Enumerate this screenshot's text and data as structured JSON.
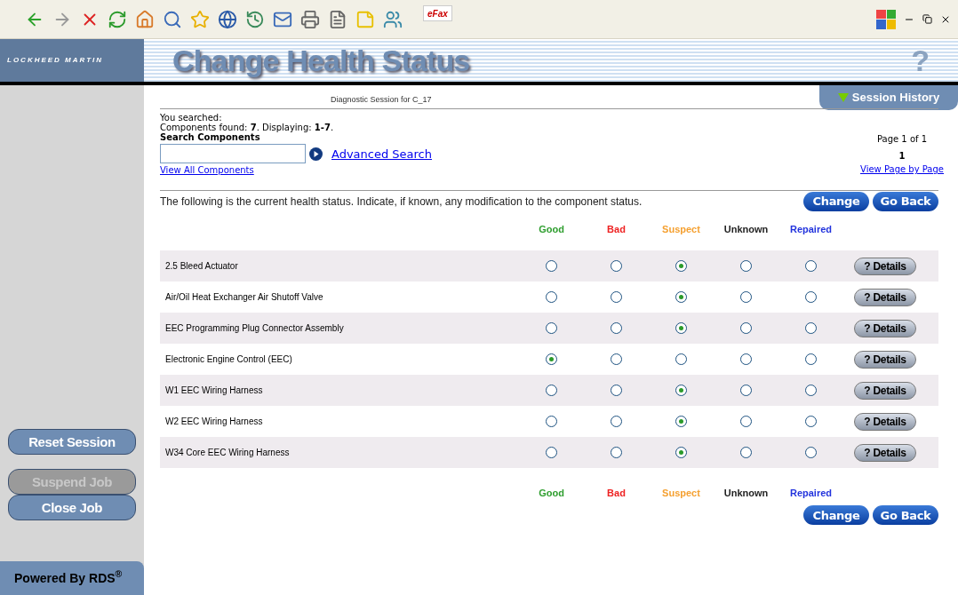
{
  "toolbar": {
    "efax_label": "eFax"
  },
  "header": {
    "brand": "LOCKHEED MARTIN",
    "title": "Change Health Status",
    "help": "?"
  },
  "sidebar": {
    "buttons": [
      {
        "label": "Reset Session",
        "disabled": false
      },
      {
        "label": "Suspend Job",
        "disabled": true
      },
      {
        "label": "Close Job",
        "disabled": false
      }
    ],
    "powered_by": "Powered By RDS$^{®}$"
  },
  "session": {
    "label": "Diagnostic Session for  C_17",
    "history_button": "Session History"
  },
  "search": {
    "searched": "You searched:",
    "found": "Components found: **7**. Displaying: **1-7**.",
    "heading": "Search Components",
    "advanced_link": "Advanced Search",
    "view_all_link": "View All Components"
  },
  "paging": {
    "page_label": "Page 1 of 1",
    "current_page": "1",
    "page_by_page_link": "View Page by Page"
  },
  "instruction": "The following is the current health status. Indicate, if known, any modification to the component status.",
  "top_buttons": [
    "Change",
    "Go Back"
  ],
  "table": {
    "header": [
      {
        "label": "Good",
        "color": "#2f9e2f"
      },
      {
        "label": "Bad",
        "color": "#ee2222"
      },
      {
        "label": "Suspect",
        "color": "#f5a030"
      },
      {
        "label": "Unknown",
        "color": "#222222"
      },
      {
        "label": "Repaired",
        "color": "#2233dd"
      }
    ],
    "rows": [
      {
        "name": "2.5 Bleed Actuator",
        "details": "? Details",
        "options": [
          {
            "selected": false
          },
          {
            "selected": false
          },
          {
            "selected": true
          },
          {
            "selected": false
          },
          {
            "selected": false
          }
        ]
      },
      {
        "name": "Air/Oil Heat Exchanger Air Shutoff Valve",
        "details": "? Details",
        "options": [
          {
            "selected": false
          },
          {
            "selected": false
          },
          {
            "selected": true
          },
          {
            "selected": false
          },
          {
            "selected": false
          }
        ]
      },
      {
        "name": "EEC Programming Plug Connector Assembly",
        "details": "? Details",
        "options": [
          {
            "selected": false
          },
          {
            "selected": false
          },
          {
            "selected": true
          },
          {
            "selected": false
          },
          {
            "selected": false
          }
        ]
      },
      {
        "name": "Electronic Engine Control (EEC)",
        "details": "? Details",
        "options": [
          {
            "selected": true
          },
          {
            "selected": false
          },
          {
            "selected": false
          },
          {
            "selected": false
          },
          {
            "selected": false
          }
        ]
      },
      {
        "name": "W1 EEC Wiring Harness",
        "details": "? Details",
        "options": [
          {
            "selected": false
          },
          {
            "selected": false
          },
          {
            "selected": true
          },
          {
            "selected": false
          },
          {
            "selected": false
          }
        ]
      },
      {
        "name": "W2 EEC Wiring Harness",
        "details": "? Details",
        "options": [
          {
            "selected": false
          },
          {
            "selected": false
          },
          {
            "selected": true
          },
          {
            "selected": false
          },
          {
            "selected": false
          }
        ]
      },
      {
        "name": "W34 Core EEC Wiring Harness",
        "details": "? Details",
        "options": [
          {
            "selected": false
          },
          {
            "selected": false
          },
          {
            "selected": true
          },
          {
            "selected": false
          },
          {
            "selected": false
          }
        ]
      }
    ],
    "footer": [
      {
        "label": "Good",
        "color": "#2f9e2f"
      },
      {
        "label": "Bad",
        "color": "#ee2222"
      },
      {
        "label": "Suspect",
        "color": "#f5a030"
      },
      {
        "label": "Unknown",
        "color": "#222222"
      },
      {
        "label": "Repaired",
        "color": "#2233dd"
      }
    ]
  },
  "bottom_buttons": [
    "Change",
    "Go Back"
  ]
}
